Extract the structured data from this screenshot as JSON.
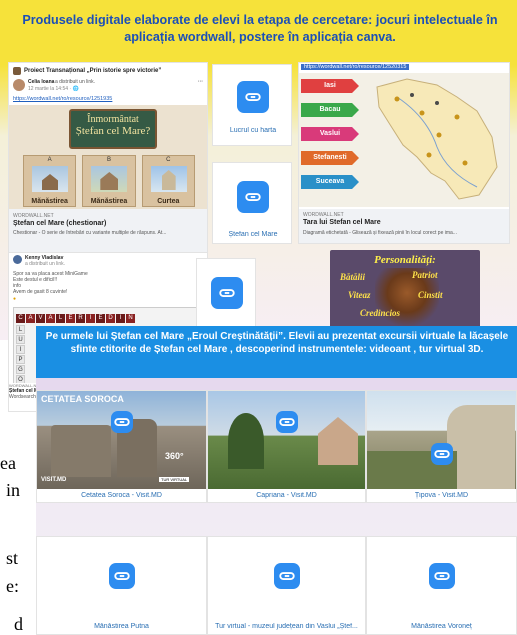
{
  "colors": {
    "accent": "#2d8cf0",
    "top_band": "#f6e23a",
    "title_blue": "#1b4fb8",
    "middle_band": "#1a8fe3"
  },
  "top_banner": {
    "title": "Produsele digitale elaborate de elevi la etapa de cercetare: jocuri intelectuale în aplicația wordwall, postere în aplicația canva."
  },
  "fb_post": {
    "group": "Proiect Transnațional „Prin istorie spre victorie”",
    "author": "Celia Ioana",
    "action": "a distribuit un link.",
    "date": "12 martie la 14:54 · 🌐",
    "url": "https://wordwall.net/ro/resource/1251935",
    "poster_title_1": "Înmormântat",
    "poster_title_2": "Ștefan cel Mare?",
    "cards": [
      {
        "letter": "A",
        "label": "Mănăstirea"
      },
      {
        "letter": "B",
        "label": "Mănăstirea"
      },
      {
        "letter": "C",
        "label": "Curtea"
      }
    ],
    "site": "WORDWALL.NET",
    "link_title": "Ștefan cel Mare (chestionar)",
    "link_desc": "Chestionar - O serie de întrebări cu variante multiple de răspuns. At...",
    "comment_author": "Kenny Vladislav",
    "comment_meta": "a distribuit un link.",
    "comment_lines": [
      "Spor sa va placa acest MiniGame",
      "Este destul e dificil!!",
      "info",
      "Avem de gasit 8 cuvinte!"
    ],
    "crossword_word": "CAVALERIEDIN",
    "crossword_col": [
      "L",
      "U",
      "I",
      "P",
      "G",
      "O",
      "C"
    ],
    "footer_site": "WORDWALL.NET",
    "footer_title": "Ștefan cel Mare",
    "footer_desc": "Wordsearch"
  },
  "link_tiles": [
    {
      "label": "Lucrul cu harta"
    },
    {
      "label": "Ștefan cel Mare"
    },
    {
      "label": ""
    }
  ],
  "map_post": {
    "url": "https://wordwall.net/ro/resource/12520315",
    "labels": [
      "Iasi",
      "Bacau",
      "Vaslui",
      "Stefanesti",
      "Suceava"
    ],
    "site": "WORDWALL.NET",
    "title": "Tara lui Stefan cel Mare",
    "desc": "Diagramă etichetată - Glisează și fixează pinii în locul corect pe ima..."
  },
  "poster": {
    "title": "Personalități:",
    "words": [
      "Bătălii",
      "Patriot",
      "Viteaz",
      "Cinstit",
      "Credincios"
    ]
  },
  "middle_banner": {
    "title": "Pe urmele lui Ștefan cel Mare „Eroul Creștinătății”. Elevii au prezentat excursii virtuale la lăcașele sfinte ctitorite de Ștefan cel Mare , descoperind instrumentele: videoant , tur virtual 3D."
  },
  "virtual_tiles": [
    {
      "label": "Cetatea Soroca - Visit.MD",
      "overlay": "CETATEA SOROCA",
      "badge": "360°",
      "badge_small": "TUR VIRTUAL",
      "brand": "VISIT.MD"
    },
    {
      "label": "Capriana - Visit.MD"
    },
    {
      "label": "Țipova - Visit.MD"
    },
    {
      "label": "Mănăstirea Putna"
    },
    {
      "label": "Tur virtual - muzeul județean din Vaslui „Ștef..."
    },
    {
      "label": "Mănăstirea Voroneț"
    }
  ],
  "doc_fragments": [
    "ea",
    "in",
    "st",
    "e:",
    "d"
  ]
}
